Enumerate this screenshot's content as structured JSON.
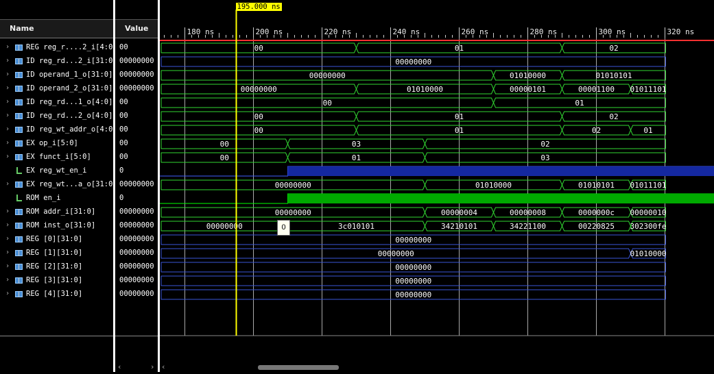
{
  "headers": {
    "name": "Name",
    "value": "Value"
  },
  "cursor": {
    "label": "195.000 ns",
    "time": 195
  },
  "timeline": {
    "start": 173.1,
    "end": 320.2,
    "major_every": 20,
    "minor_every": 2,
    "ticks": [
      {
        "t": 180,
        "label": "180 ns"
      },
      {
        "t": 200,
        "label": "200 ns"
      },
      {
        "t": 220,
        "label": "220 ns"
      },
      {
        "t": 240,
        "label": "240 ns"
      },
      {
        "t": 260,
        "label": "260 ns"
      },
      {
        "t": 280,
        "label": "280 ns"
      },
      {
        "t": 300,
        "label": "300 ns"
      },
      {
        "t": 320,
        "label": "320 ns"
      }
    ]
  },
  "colors": {
    "bus": "#32d732",
    "bus_dim": "#3a56d8",
    "bit_high": "#00aa00",
    "bit_high_blue": "#1428a0",
    "cursor": "#ffff00",
    "marker": "#ff3030"
  },
  "tooltip": "0",
  "signals": [
    {
      "name": "REG reg_r....2_i[4:0]",
      "value": "00",
      "kind": "bus",
      "color": "#32d732",
      "segs": [
        {
          "t0": 173.1,
          "t1": 230,
          "label": "00"
        },
        {
          "t0": 230,
          "t1": 290,
          "label": "01"
        },
        {
          "t0": 290,
          "t1": 320.2,
          "label": "02"
        }
      ]
    },
    {
      "name": "ID reg_rd...2_i[31:0]",
      "value": "00000000",
      "kind": "bus",
      "color": "#3a56d8",
      "segs": [
        {
          "t0": 173.1,
          "t1": 320.2,
          "label": "00000000"
        }
      ]
    },
    {
      "name": "ID operand_1_o[31:0]",
      "value": "00000000",
      "kind": "bus",
      "color": "#32d732",
      "segs": [
        {
          "t0": 173.1,
          "t1": 270,
          "label": "00000000"
        },
        {
          "t0": 270,
          "t1": 290,
          "label": "01010000"
        },
        {
          "t0": 290,
          "t1": 320.2,
          "label": "01010101"
        }
      ]
    },
    {
      "name": "ID operand_2_o[31:0]",
      "value": "00000000",
      "kind": "bus",
      "color": "#32d732",
      "segs": [
        {
          "t0": 173.1,
          "t1": 230,
          "label": "00000000"
        },
        {
          "t0": 230,
          "t1": 270,
          "label": "01010000"
        },
        {
          "t0": 270,
          "t1": 290,
          "label": "00000101"
        },
        {
          "t0": 290,
          "t1": 310,
          "label": "00001100"
        },
        {
          "t0": 310,
          "t1": 320.2,
          "label": "01011101"
        }
      ]
    },
    {
      "name": "ID reg_rd...1_o[4:0]",
      "value": "00",
      "kind": "bus",
      "color": "#32d732",
      "segs": [
        {
          "t0": 173.1,
          "t1": 270,
          "label": "00"
        },
        {
          "t0": 270,
          "t1": 320.2,
          "label": "01"
        }
      ]
    },
    {
      "name": "ID reg_rd...2_o[4:0]",
      "value": "00",
      "kind": "bus",
      "color": "#32d732",
      "segs": [
        {
          "t0": 173.1,
          "t1": 230,
          "label": "00"
        },
        {
          "t0": 230,
          "t1": 290,
          "label": "01"
        },
        {
          "t0": 290,
          "t1": 320.2,
          "label": "02"
        }
      ]
    },
    {
      "name": "ID reg_wt_addr_o[4:0]",
      "value": "00",
      "kind": "bus",
      "color": "#32d732",
      "segs": [
        {
          "t0": 173.1,
          "t1": 230,
          "label": "00"
        },
        {
          "t0": 230,
          "t1": 290,
          "label": "01"
        },
        {
          "t0": 290,
          "t1": 310,
          "label": "02"
        },
        {
          "t0": 310,
          "t1": 320.2,
          "label": "01"
        }
      ]
    },
    {
      "name": "EX op_i[5:0]",
      "value": "00",
      "kind": "bus",
      "color": "#32d732",
      "segs": [
        {
          "t0": 173.1,
          "t1": 210,
          "label": "00"
        },
        {
          "t0": 210,
          "t1": 250,
          "label": "03"
        },
        {
          "t0": 250,
          "t1": 320.2,
          "label": "02"
        }
      ]
    },
    {
      "name": "EX funct_i[5:0]",
      "value": "00",
      "kind": "bus",
      "color": "#32d732",
      "segs": [
        {
          "t0": 173.1,
          "t1": 210,
          "label": "00"
        },
        {
          "t0": 210,
          "t1": 250,
          "label": "01"
        },
        {
          "t0": 250,
          "t1": 320.2,
          "label": "03"
        }
      ]
    },
    {
      "name": "EX reg_wt_en_i",
      "value": "0",
      "kind": "bit",
      "color": "#1428a0",
      "rise": 210
    },
    {
      "name": "EX reg_wt...a_o[31:0]",
      "value": "00000000",
      "kind": "bus",
      "color": "#32d732",
      "segs": [
        {
          "t0": 173.1,
          "t1": 250,
          "label": "00000000"
        },
        {
          "t0": 250,
          "t1": 290,
          "label": "01010000"
        },
        {
          "t0": 290,
          "t1": 310,
          "label": "01010101"
        },
        {
          "t0": 310,
          "t1": 320.2,
          "label": "01011101"
        }
      ]
    },
    {
      "name": "ROM en_i",
      "value": "0",
      "kind": "bit",
      "color": "#00aa00",
      "rise": 210
    },
    {
      "name": "ROM addr_i[31:0]",
      "value": "00000000",
      "kind": "bus",
      "color": "#32d732",
      "segs": [
        {
          "t0": 173.1,
          "t1": 250,
          "label": "00000000"
        },
        {
          "t0": 250,
          "t1": 270,
          "label": "00000004"
        },
        {
          "t0": 270,
          "t1": 290,
          "label": "00000008"
        },
        {
          "t0": 290,
          "t1": 310,
          "label": "0000000c"
        },
        {
          "t0": 310,
          "t1": 320.2,
          "label": "00000010"
        }
      ]
    },
    {
      "name": "ROM inst_o[31:0]",
      "value": "00000000",
      "kind": "bus",
      "color": "#32d732",
      "segs": [
        {
          "t0": 173.1,
          "t1": 210,
          "label": "00000000"
        },
        {
          "t0": 210,
          "t1": 250,
          "label": "3c010101"
        },
        {
          "t0": 250,
          "t1": 270,
          "label": "34210101"
        },
        {
          "t0": 270,
          "t1": 290,
          "label": "34221100"
        },
        {
          "t0": 290,
          "t1": 310,
          "label": "00220825"
        },
        {
          "t0": 310,
          "t1": 320.2,
          "label": "302300fe"
        }
      ]
    },
    {
      "name": "REG [0][31:0]",
      "value": "00000000",
      "kind": "bus",
      "color": "#3a56d8",
      "segs": [
        {
          "t0": 173.1,
          "t1": 320.2,
          "label": "00000000"
        }
      ]
    },
    {
      "name": "REG [1][31:0]",
      "value": "00000000",
      "kind": "bus",
      "color": "#3a56d8",
      "segs": [
        {
          "t0": 173.1,
          "t1": 310,
          "label": "00000000"
        },
        {
          "t0": 310,
          "t1": 320.2,
          "label": "01010000"
        }
      ]
    },
    {
      "name": "REG [2][31:0]",
      "value": "00000000",
      "kind": "bus",
      "color": "#3a56d8",
      "segs": [
        {
          "t0": 173.1,
          "t1": 320.2,
          "label": "00000000"
        }
      ]
    },
    {
      "name": "REG [3][31:0]",
      "value": "00000000",
      "kind": "bus",
      "color": "#3a56d8",
      "segs": [
        {
          "t0": 173.1,
          "t1": 320.2,
          "label": "00000000"
        }
      ]
    },
    {
      "name": "REG [4][31:0]",
      "value": "00000000",
      "kind": "bus",
      "color": "#3a56d8",
      "segs": [
        {
          "t0": 173.1,
          "t1": 320.2,
          "label": "00000000"
        }
      ]
    }
  ],
  "scroll": {
    "left_arrow": "‹",
    "right_arrow": "›"
  }
}
